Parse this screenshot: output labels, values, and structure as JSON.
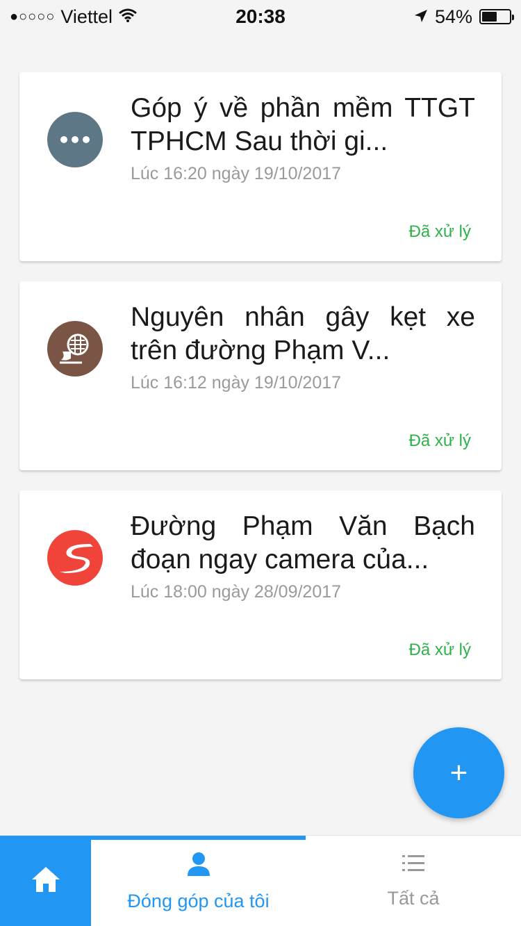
{
  "status_bar": {
    "signal": "●○○○○",
    "carrier": "Viettel",
    "time": "20:38",
    "battery": "54%",
    "battery_level": 0.54
  },
  "cards": [
    {
      "title": "Góp ý về phần mềm TTGT TPHCM Sau thời gi...",
      "time": "Lúc 16:20 ngày 19/10/2017",
      "status": "Đã xử lý",
      "icon": "more-dots-icon",
      "icon_color": "#5e7787"
    },
    {
      "title": "Nguyên nhân gây kẹt xe trên đường Phạm V...",
      "time": "Lúc 16:12 ngày 19/10/2017",
      "status": "Đã xử lý",
      "icon": "drain-icon",
      "icon_color": "#7a5445"
    },
    {
      "title": "Đường Phạm Văn Bạch đoạn ngay camera của...",
      "time": "Lúc 18:00 ngày 28/09/2017",
      "status": "Đã xử lý",
      "icon": "road-icon",
      "icon_color": "#f0433a"
    }
  ],
  "fab": {
    "label": "+",
    "color": "#2196f3"
  },
  "tabs": {
    "home_icon": "home-icon",
    "mine_label": "Đóng góp của tôi",
    "all_label": "Tất cả"
  },
  "colors": {
    "accent": "#2196f3",
    "status_done": "#2fb14a"
  }
}
